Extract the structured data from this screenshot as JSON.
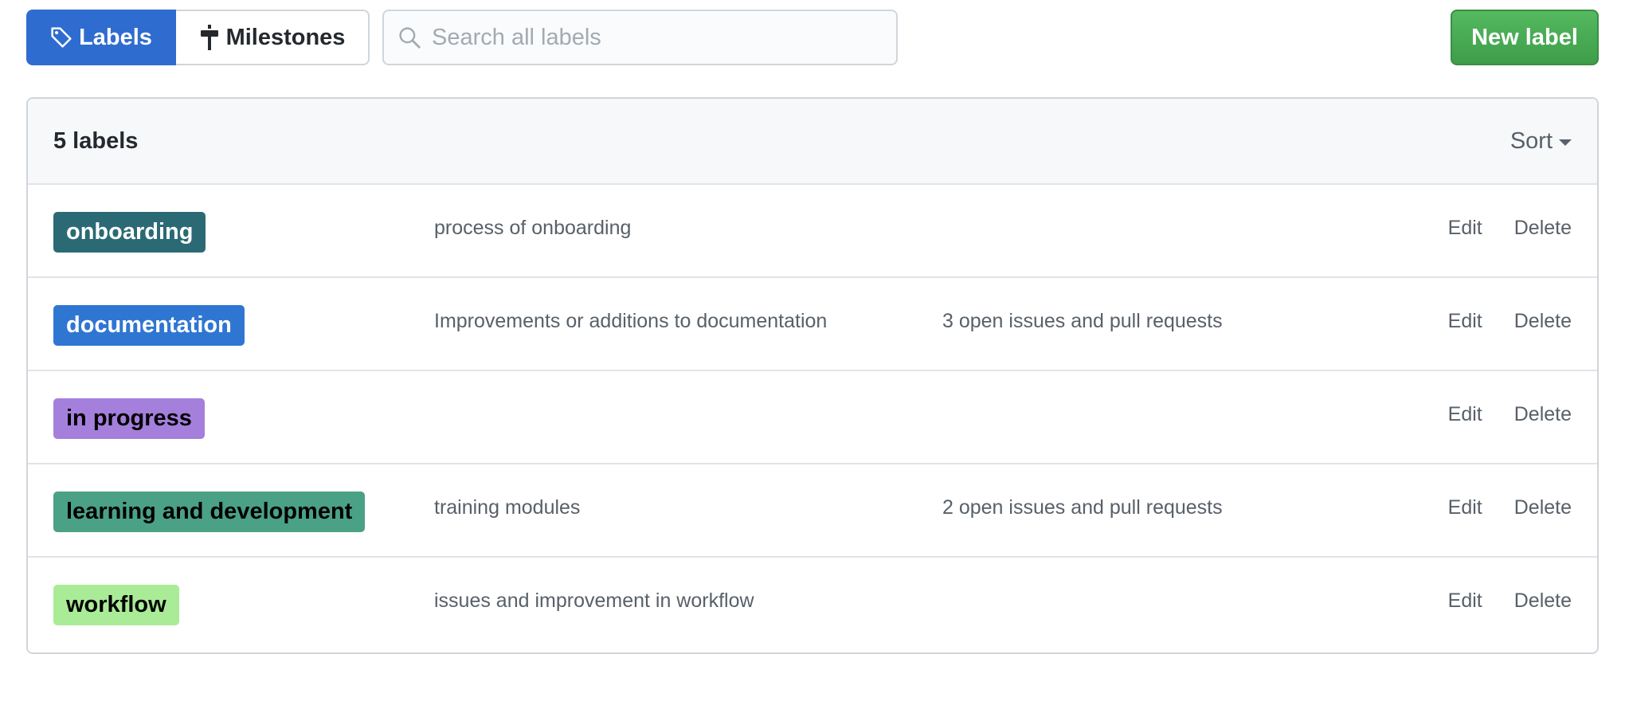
{
  "toolbar": {
    "labels_tab": "Labels",
    "milestones_tab": "Milestones",
    "search_placeholder": "Search all labels",
    "new_label_button": "New label"
  },
  "list": {
    "count_text": "5 labels",
    "sort_label": "Sort",
    "rows": [
      {
        "name": "onboarding",
        "color": "#2b6a74",
        "text_color": "#ffffff",
        "description": "process of onboarding",
        "issues": "",
        "edit": "Edit",
        "delete": "Delete"
      },
      {
        "name": "documentation",
        "color": "#2f76d2",
        "text_color": "#ffffff",
        "description": "Improvements or additions to documentation",
        "issues": "3 open issues and pull requests",
        "edit": "Edit",
        "delete": "Delete"
      },
      {
        "name": "in progress",
        "color": "#a57fdc",
        "text_color": "#000000",
        "description": "",
        "issues": "",
        "edit": "Edit",
        "delete": "Delete"
      },
      {
        "name": "learning and development",
        "color": "#4aa185",
        "text_color": "#000000",
        "description": "training modules",
        "issues": "2 open issues and pull requests",
        "edit": "Edit",
        "delete": "Delete"
      },
      {
        "name": "workflow",
        "color": "#aaeb97",
        "text_color": "#000000",
        "description": "issues and improvement in workflow",
        "issues": "",
        "edit": "Edit",
        "delete": "Delete"
      }
    ]
  },
  "colors": {
    "primary_blue": "#2f6ccf",
    "new_label_green": "#46a94f"
  },
  "icons": {
    "labels_tab": "tag-icon",
    "milestones_tab": "milestone-signpost-icon",
    "search": "search-icon",
    "sort": "caret-down-icon"
  }
}
